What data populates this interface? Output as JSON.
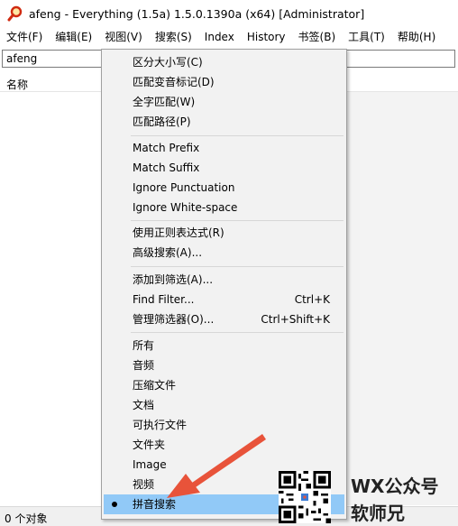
{
  "window": {
    "title": "afeng - Everything (1.5a) 1.5.0.1390a (x64) [Administrator]"
  },
  "menubar": [
    {
      "label": "文件(F)"
    },
    {
      "label": "编辑(E)"
    },
    {
      "label": "视图(V)"
    },
    {
      "label": "搜索(S)"
    },
    {
      "label": "Index"
    },
    {
      "label": "History"
    },
    {
      "label": "书签(B)"
    },
    {
      "label": "工具(T)"
    },
    {
      "label": "帮助(H)"
    }
  ],
  "search": {
    "value": "afeng"
  },
  "list": {
    "column_name": "名称"
  },
  "status": {
    "text": "0 个对象"
  },
  "context_menu": {
    "items": [
      {
        "label": "区分大小写(C)",
        "shortcut": ""
      },
      {
        "label": "匹配变音标记(D)",
        "shortcut": ""
      },
      {
        "label": "全字匹配(W)",
        "shortcut": ""
      },
      {
        "label": "匹配路径(P)",
        "shortcut": ""
      },
      {
        "label": "Match Prefix",
        "shortcut": ""
      },
      {
        "label": "Match Suffix",
        "shortcut": ""
      },
      {
        "label": "Ignore Punctuation",
        "shortcut": ""
      },
      {
        "label": "Ignore White-space",
        "shortcut": ""
      },
      {
        "label": "使用正则表达式(R)",
        "shortcut": ""
      },
      {
        "label": "高级搜索(A)...",
        "shortcut": ""
      },
      {
        "label": "添加到筛选(A)...",
        "shortcut": ""
      },
      {
        "label": "Find Filter...",
        "shortcut": "Ctrl+K"
      },
      {
        "label": "管理筛选器(O)...",
        "shortcut": "Ctrl+Shift+K"
      },
      {
        "label": "所有",
        "shortcut": ""
      },
      {
        "label": "音频",
        "shortcut": ""
      },
      {
        "label": "压缩文件",
        "shortcut": ""
      },
      {
        "label": "文档",
        "shortcut": ""
      },
      {
        "label": "可执行文件",
        "shortcut": ""
      },
      {
        "label": "文件夹",
        "shortcut": ""
      },
      {
        "label": "Image",
        "shortcut": ""
      },
      {
        "label": "视频",
        "shortcut": ""
      },
      {
        "label": "拼音搜索",
        "shortcut": "",
        "checked": true
      }
    ]
  },
  "watermark": {
    "line1": "WX公众号",
    "line2": "软师兄"
  },
  "colors": {
    "menu_bg": "#f2f2f2",
    "selected": "#91c9f7",
    "arrow": "#e8533a"
  },
  "icons": {
    "app": "magnifier-icon",
    "checked": "bullet-icon"
  }
}
